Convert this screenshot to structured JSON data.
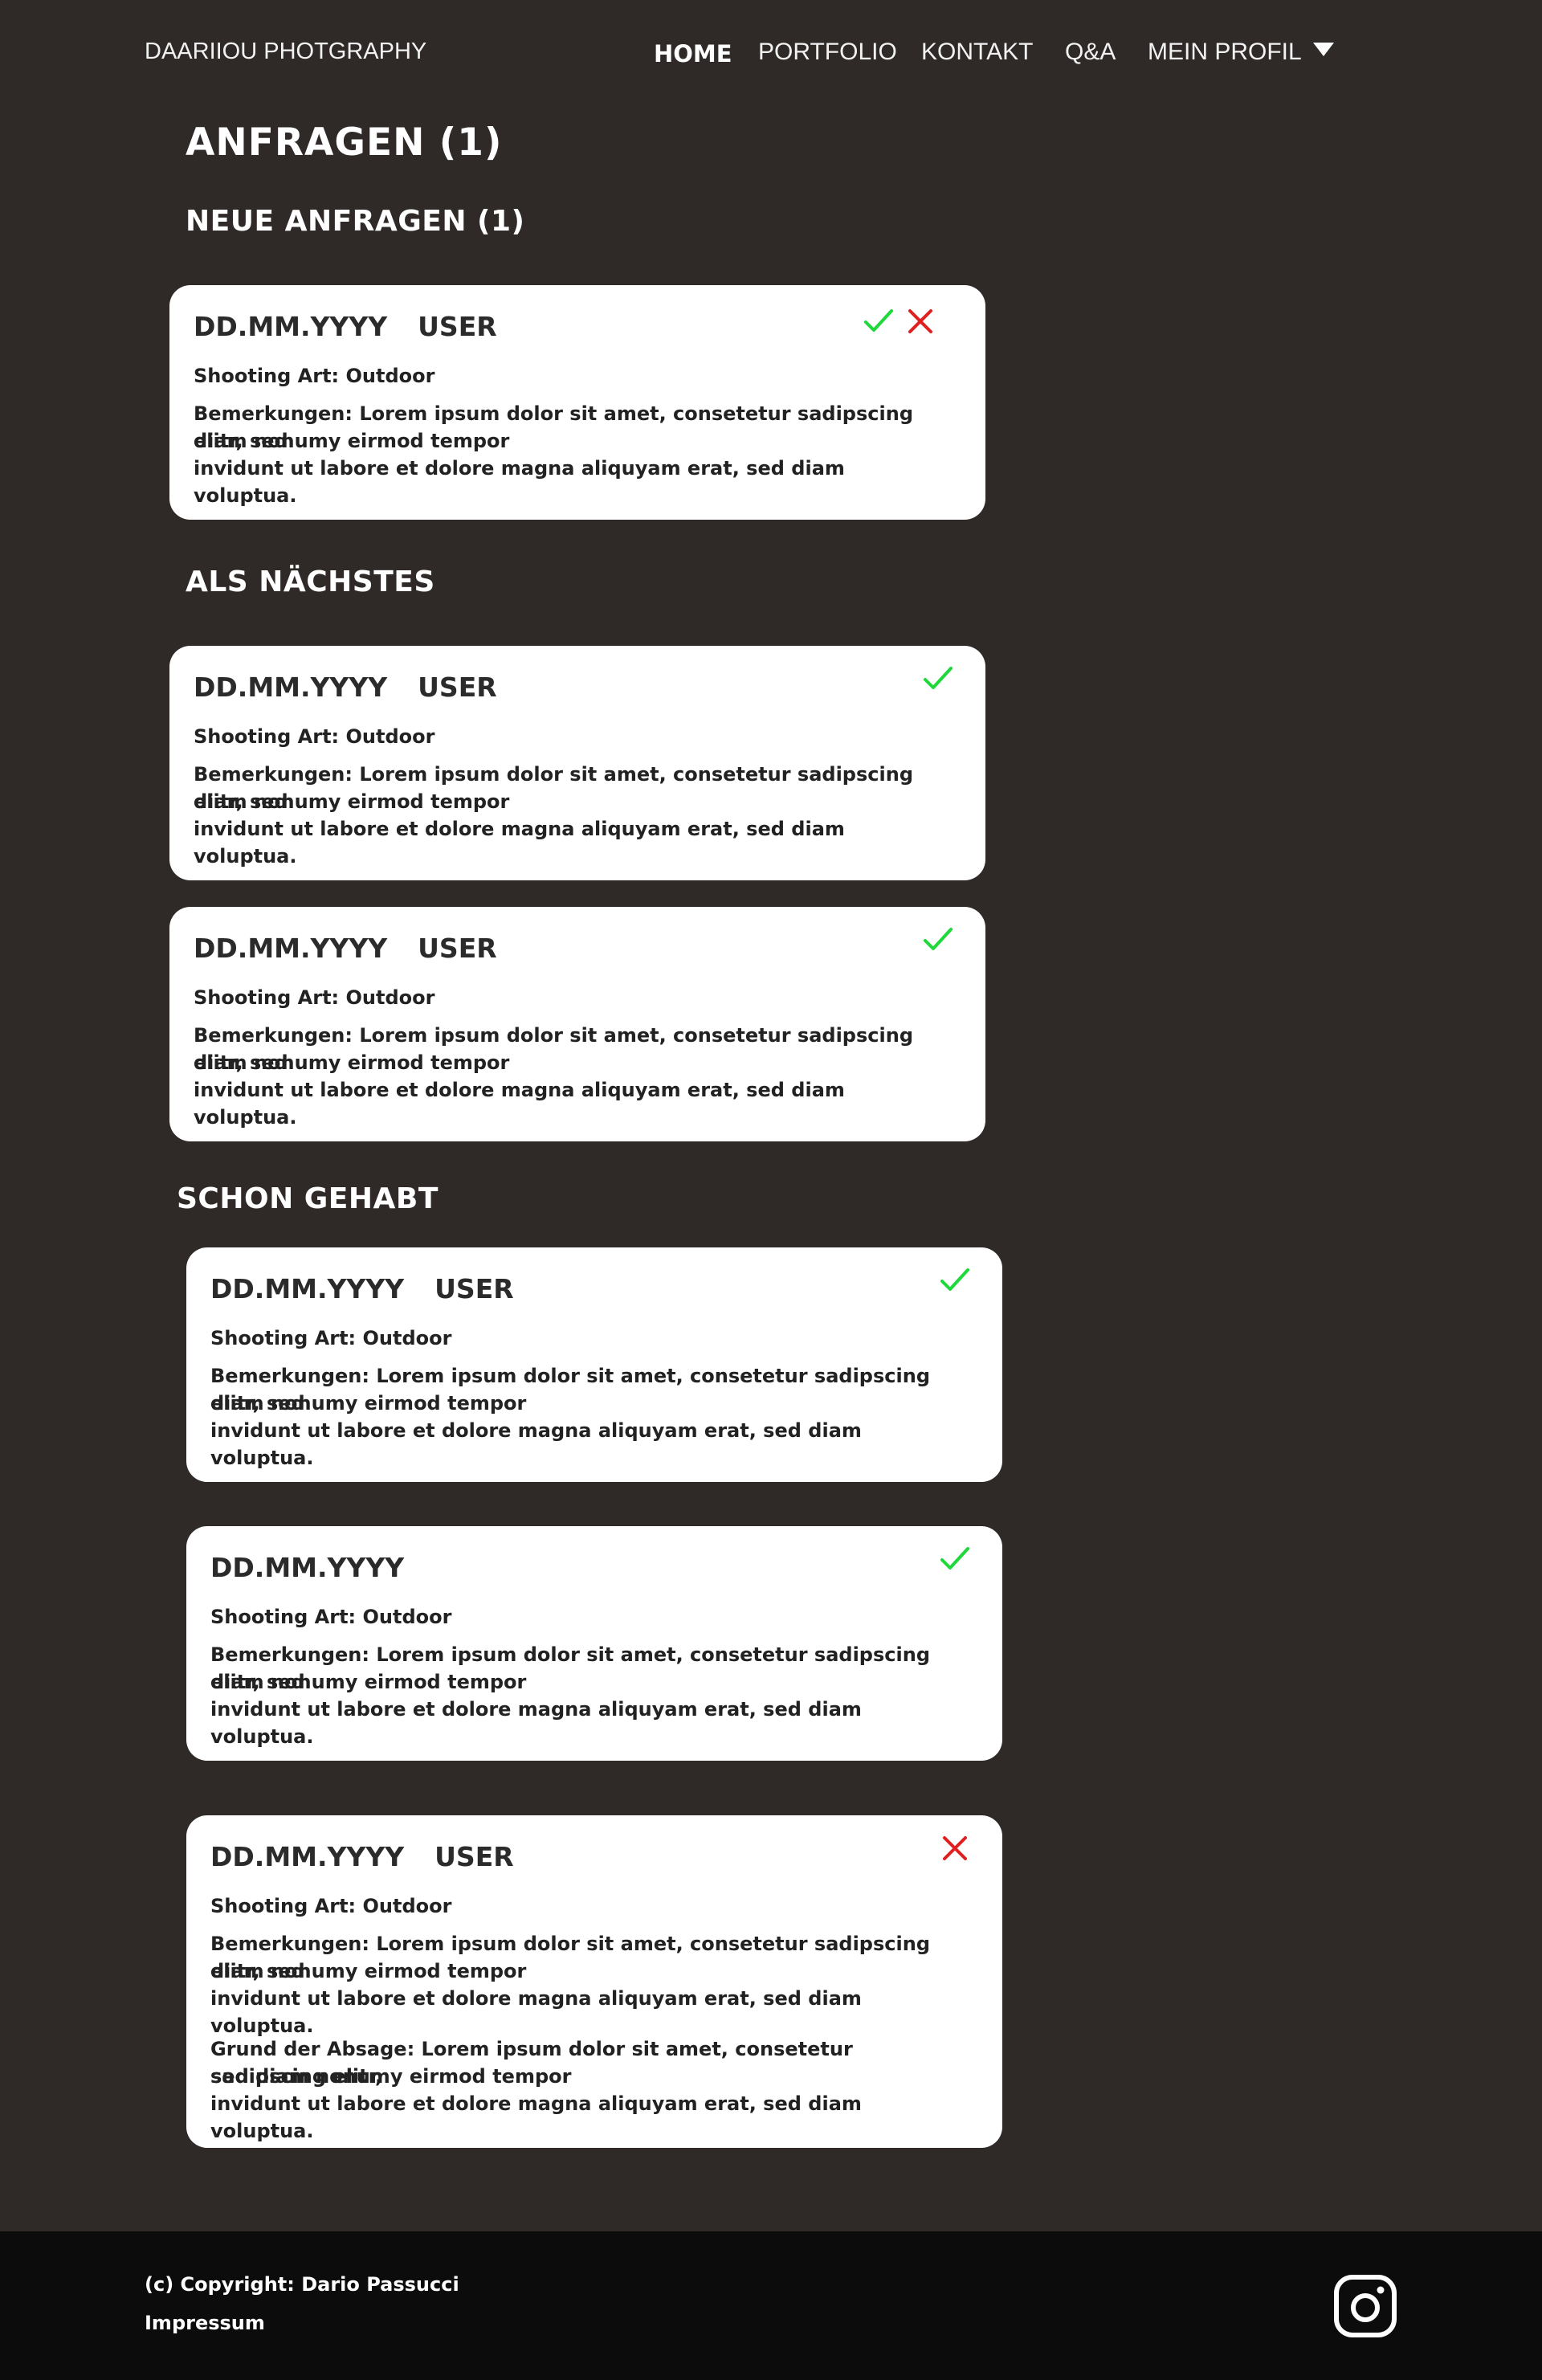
{
  "header": {
    "brand": "DAARIIOU PHOTGRAPHY",
    "nav": {
      "home": "HOME",
      "portfolio": "PORTFOLIO",
      "kontakt": "KONTAKT",
      "qa": "Q&A",
      "profil": "MEIN PROFIL"
    }
  },
  "page": {
    "title": "ANFRAGEN (1)",
    "section_new": "NEUE ANFRAGEN (1)",
    "section_next": "ALS NÄCHSTES",
    "section_past": "SCHON GEHABT"
  },
  "colors": {
    "accept": "#1fd83a",
    "reject": "#e02020",
    "background": "#2f2a28",
    "footer": "#0c0c0c"
  },
  "requests": [
    {
      "date": "DD.MM.YYYY",
      "user": "USER",
      "shooting": "Shooting Art: Outdoor",
      "remarks_1": "Bemerkungen: Lorem ipsum dolor sit amet, consetetur sadipscing elitr, sed",
      "remarks_2": "diam nonumy eirmod tempor",
      "remarks_3": "invidunt ut labore et dolore magna aliquyam erat, sed diam voluptua.",
      "icons": [
        "check-icon",
        "x-icon"
      ]
    },
    {
      "date": "DD.MM.YYYY",
      "user": "USER",
      "shooting": "Shooting Art: Outdoor",
      "remarks_1": "Bemerkungen: Lorem ipsum dolor sit amet, consetetur sadipscing elitr, sed",
      "remarks_2": "diam nonumy eirmod tempor",
      "remarks_3": "invidunt ut labore et dolore magna aliquyam erat, sed diam voluptua.",
      "icons": [
        "check-icon"
      ]
    },
    {
      "date": "DD.MM.YYYY",
      "user": "USER",
      "shooting": "Shooting Art: Outdoor",
      "remarks_1": "Bemerkungen: Lorem ipsum dolor sit amet, consetetur sadipscing elitr, sed",
      "remarks_2": "diam nonumy eirmod tempor",
      "remarks_3": "invidunt ut labore et dolore magna aliquyam erat, sed diam voluptua.",
      "icons": [
        "check-icon"
      ]
    },
    {
      "date": "DD.MM.YYYY",
      "user": "USER",
      "shooting": "Shooting Art: Outdoor",
      "remarks_1": "Bemerkungen: Lorem ipsum dolor sit amet, consetetur sadipscing elitr, sed",
      "remarks_2": "diam nonumy eirmod tempor",
      "remarks_3": "invidunt ut labore et dolore magna aliquyam erat, sed diam voluptua.",
      "icons": [
        "check-icon"
      ]
    },
    {
      "date": "DD.MM.YYYY",
      "user": "",
      "shooting": "Shooting Art: Outdoor",
      "remarks_1": "Bemerkungen: Lorem ipsum dolor sit amet, consetetur sadipscing elitr, sed",
      "remarks_2": "diam nonumy eirmod tempor",
      "remarks_3": "invidunt ut labore et dolore magna aliquyam erat, sed diam voluptua.",
      "icons": [
        "check-icon"
      ]
    },
    {
      "date": "DD.MM.YYYY",
      "user": "USER",
      "shooting": "Shooting Art: Outdoor",
      "remarks_1": "Bemerkungen: Lorem ipsum dolor sit amet, consetetur sadipscing elitr, sed",
      "remarks_2": "diam nonumy eirmod tempor",
      "remarks_3": "invidunt ut labore et dolore magna aliquyam erat, sed diam voluptua.",
      "reason_1": "Grund der Absage: Lorem ipsum dolor sit amet, consetetur sadipscing elitr,",
      "reason_2": "sed diam nonumy eirmod tempor",
      "reason_3": "invidunt ut labore et dolore magna aliquyam erat, sed diam voluptua.",
      "icons": [
        "x-icon"
      ]
    }
  ],
  "footer": {
    "copyright": "(c) Copyright: Dario Passucci",
    "impressum": "Impressum",
    "social_icon": "instagram-icon"
  }
}
